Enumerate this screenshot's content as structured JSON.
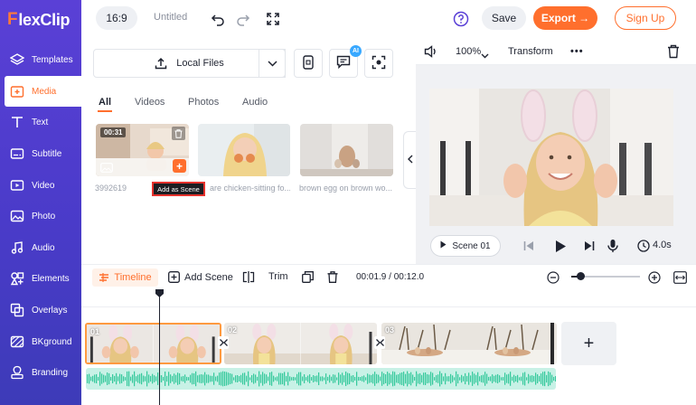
{
  "app": {
    "logo_text": "FlexClip",
    "logo_letter": "F"
  },
  "sidebar": {
    "items": [
      {
        "label": "Templates",
        "icon": "layers-icon"
      },
      {
        "label": "Media",
        "icon": "media-folder-icon",
        "active": true
      },
      {
        "label": "Text",
        "icon": "text-icon"
      },
      {
        "label": "Subtitle",
        "icon": "subtitle-icon"
      },
      {
        "label": "Video",
        "icon": "video-icon"
      },
      {
        "label": "Photo",
        "icon": "photo-icon"
      },
      {
        "label": "Audio",
        "icon": "music-icon"
      },
      {
        "label": "Elements",
        "icon": "elements-icon"
      },
      {
        "label": "Overlays",
        "icon": "overlays-icon"
      },
      {
        "label": "BKground",
        "icon": "background-icon"
      },
      {
        "label": "Branding",
        "icon": "branding-icon"
      }
    ]
  },
  "topbar": {
    "ratio": "16:9",
    "project_title": "Untitled",
    "save_label": "Save",
    "export_label": "Export →",
    "signup_label": "Sign Up"
  },
  "media": {
    "local_files_label": "Local Files",
    "ai_badge": "AI",
    "tabs": [
      "All",
      "Videos",
      "Photos",
      "Audio"
    ],
    "active_tab": "All",
    "items": [
      {
        "caption": "3992619",
        "duration": "00:31",
        "kind": "video"
      },
      {
        "caption": "are chicken-sitting fo...",
        "kind": "photo"
      },
      {
        "caption": "brown egg on brown wo...",
        "kind": "photo"
      }
    ],
    "tooltip": "Add as Scene"
  },
  "preview": {
    "zoom": "100%",
    "transform_label": "Transform",
    "more_label": "•••",
    "scene_label": "Scene 01",
    "duration": "4.0s"
  },
  "timeline": {
    "tab_label": "Timeline",
    "add_scene_label": "Add Scene",
    "trim_label": "Trim",
    "time_current": "00:01.9",
    "time_total": "00:12.0",
    "time_display": "00:01.9 / 00:12.0",
    "clips": [
      {
        "num": "01",
        "selected": true
      },
      {
        "num": "02"
      },
      {
        "num": "03"
      }
    ],
    "add_clip_label": "+"
  },
  "colors": {
    "accent": "#ff6f2d",
    "sidebar": "#4a3bc9",
    "audio_wave": "#33c99b"
  }
}
